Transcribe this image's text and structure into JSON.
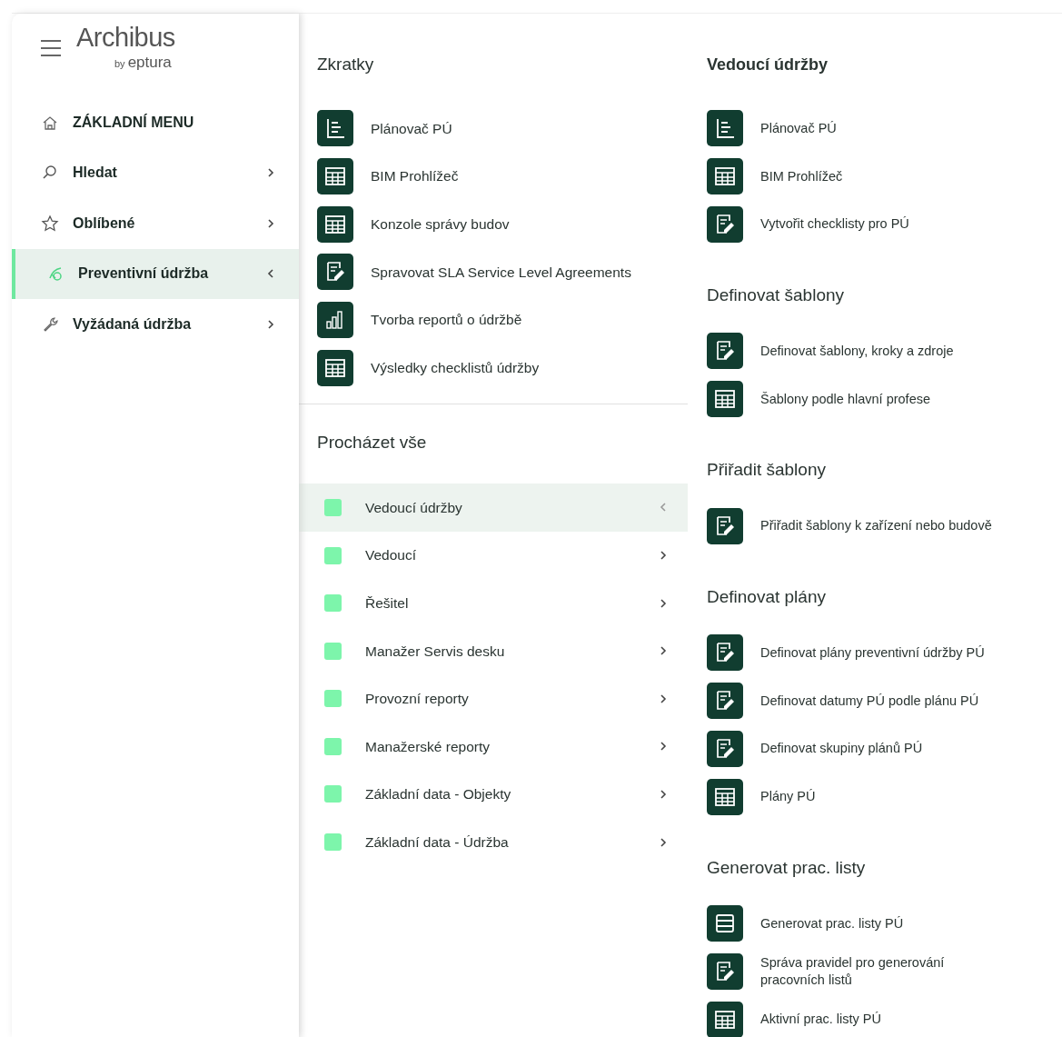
{
  "brand": {
    "name": "Archibus",
    "byline": "by",
    "sub": "eptura"
  },
  "sidebar": {
    "items": [
      {
        "kind": "home",
        "label": "ZÁKLADNÍ MENU",
        "selected": false
      },
      {
        "kind": "search",
        "label": "Hledat",
        "selected": false,
        "expanded": false
      },
      {
        "kind": "star",
        "label": "Oblíbené",
        "selected": false,
        "expanded": false
      },
      {
        "kind": "pm",
        "label": "Preventivní údržba",
        "selected": true,
        "expanded": true
      },
      {
        "kind": "wrench",
        "label": "Vyžádaná údržba",
        "selected": false,
        "expanded": false
      }
    ]
  },
  "shortcuts": {
    "title": "Zkratky",
    "items": [
      {
        "kind": "gantt",
        "label": "Plánovač PÚ"
      },
      {
        "kind": "table",
        "label": "BIM Prohlížeč"
      },
      {
        "kind": "table",
        "label": "Konzole správy budov"
      },
      {
        "kind": "edit",
        "label": "Spravovat SLA Service Level Agreements"
      },
      {
        "kind": "chart",
        "label": "Tvorba reportů o údržbě"
      },
      {
        "kind": "table",
        "label": "Výsledky checklistů údržby"
      }
    ]
  },
  "browse": {
    "title": "Procházet vše",
    "roles": [
      {
        "label": "Vedoucí údržby",
        "selected": true,
        "expanded": true,
        "color": "#7df5ab"
      },
      {
        "label": "Vedoucí",
        "selected": false,
        "expanded": false,
        "color": "#7df5ab"
      },
      {
        "label": "Řešitel",
        "selected": false,
        "expanded": false,
        "color": "#7df5ab"
      },
      {
        "label": "Manažer Servis desku",
        "selected": false,
        "expanded": false,
        "color": "#7df5ab"
      },
      {
        "label": "Provozní reporty",
        "selected": false,
        "expanded": false,
        "color": "#7df5ab"
      },
      {
        "label": "Manažerské reporty",
        "selected": false,
        "expanded": false,
        "color": "#7df5ab"
      },
      {
        "label": "Základní data - Objekty",
        "selected": false,
        "expanded": false,
        "color": "#7df5ab"
      },
      {
        "label": "Základní data - Údržba",
        "selected": false,
        "expanded": false,
        "color": "#7df5ab"
      }
    ]
  },
  "role_panel": {
    "title": "Vedoucí údržby",
    "groups": [
      {
        "items": [
          {
            "kind": "gantt",
            "label": "Plánovač PÚ"
          },
          {
            "kind": "table",
            "label": "BIM Prohlížeč"
          },
          {
            "kind": "edit",
            "label": "Vytvořit checklisty pro PÚ"
          }
        ]
      },
      {
        "title": "Definovat šablony",
        "items": [
          {
            "kind": "edit",
            "label": "Definovat šablony, kroky a zdroje"
          },
          {
            "kind": "table",
            "label": "Šablony podle hlavní profese"
          }
        ]
      },
      {
        "title": "Přiřadit šablony",
        "items": [
          {
            "kind": "edit",
            "label": "Přiřadit šablony k zařízení nebo budově"
          }
        ]
      },
      {
        "title": "Definovat plány",
        "items": [
          {
            "kind": "edit",
            "label": "Definovat plány preventivní údržby PÚ"
          },
          {
            "kind": "edit",
            "label": "Definovat datumy PÚ podle plánu PÚ"
          },
          {
            "kind": "edit",
            "label": "Definovat skupiny plánů PÚ"
          },
          {
            "kind": "table",
            "label": "Plány PÚ"
          }
        ]
      },
      {
        "title": "Generovat prac. listy",
        "items": [
          {
            "kind": "list",
            "label": "Generovat prac. listy PÚ"
          },
          {
            "kind": "edit",
            "label": "Správa pravidel pro generování pracovních listů"
          },
          {
            "kind": "table",
            "label": "Aktivní prac. listy PÚ"
          }
        ]
      }
    ]
  }
}
